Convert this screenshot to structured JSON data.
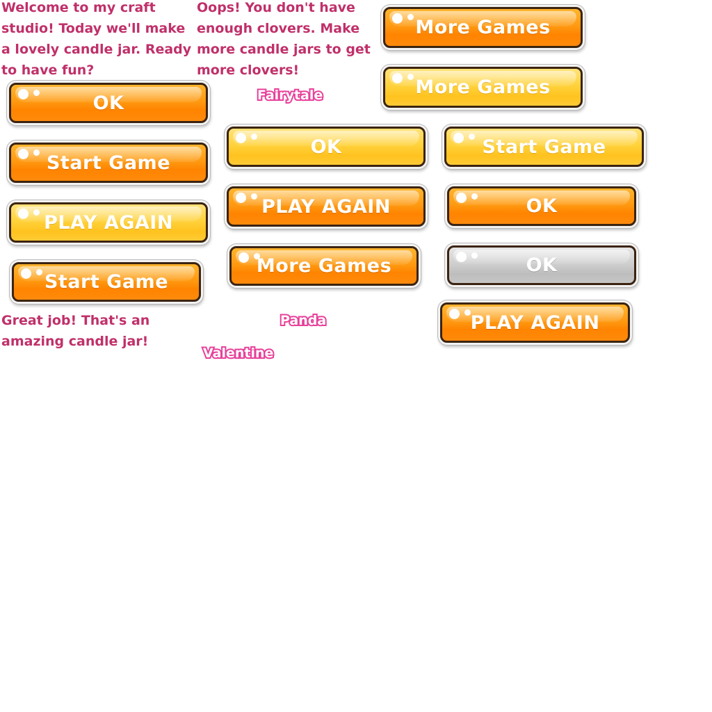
{
  "messages": {
    "welcome": "Welcome to my craft\nstudio! Today we'll make\na lovely candle jar. Ready\nto have fun?",
    "oops": "Oops! You don't have\nenough clovers. Make\nmore candle jars to get\nmore clovers!",
    "great_job": "Great job! That's an\namazing candle jar!"
  },
  "tags": {
    "fairytale": "Fairytale",
    "panda": "Panda",
    "valentine": "Valentine"
  },
  "buttons": {
    "ok_1": "OK",
    "start_game_1": "Start Game",
    "play_again_1": "PLAY AGAIN",
    "start_game_2": "Start Game",
    "more_games_1": "More Games",
    "more_games_2": "More Games",
    "ok_2": "OK",
    "start_game_3": "Start Game",
    "play_again_2": "PLAY AGAIN",
    "ok_3": "OK",
    "more_games_3": "More Games",
    "ok_disabled": "OK",
    "play_again_3": "PLAY AGAIN"
  },
  "colors": {
    "message_text": "#c0306a",
    "tag_outline": "#e8409a",
    "button_orange": "#ff9a12",
    "button_yellow": "#ffd23c",
    "button_gray": "#cfcfcf",
    "button_border": "#3b2411"
  }
}
